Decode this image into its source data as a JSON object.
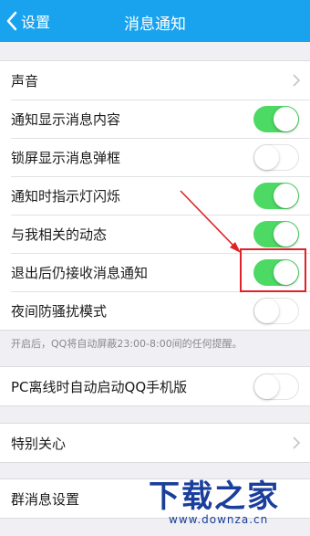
{
  "header": {
    "back_label": "设置",
    "title": "消息通知"
  },
  "group1": [
    {
      "label": "声音",
      "control": "chevron"
    },
    {
      "label": "通知显示消息内容",
      "control": "toggle",
      "on": true
    },
    {
      "label": "锁屏显示消息弹框",
      "control": "toggle",
      "on": false
    },
    {
      "label": "通知时指示灯闪烁",
      "control": "toggle",
      "on": true
    },
    {
      "label": "与我相关的动态",
      "control": "toggle",
      "on": true
    },
    {
      "label": "退出后仍接收消息通知",
      "control": "toggle",
      "on": true
    },
    {
      "label": "夜间防骚扰模式",
      "control": "toggle",
      "on": false
    }
  ],
  "night_note": "开启后，QQ将自动屏蔽23:00-8:00间的任何提醒。",
  "group2": [
    {
      "label": "PC离线时自动启动QQ手机版",
      "control": "toggle",
      "on": false
    }
  ],
  "group3": [
    {
      "label": "特别关心",
      "control": "chevron"
    }
  ],
  "group4": [
    {
      "label": "群消息设置",
      "control": "none"
    }
  ],
  "watermark": {
    "text": "下载之家",
    "url": "www.downza.cn"
  },
  "colors": {
    "navbar": "#19a3ef",
    "toggle_on": "#4cd964",
    "highlight": "#e0222a"
  }
}
